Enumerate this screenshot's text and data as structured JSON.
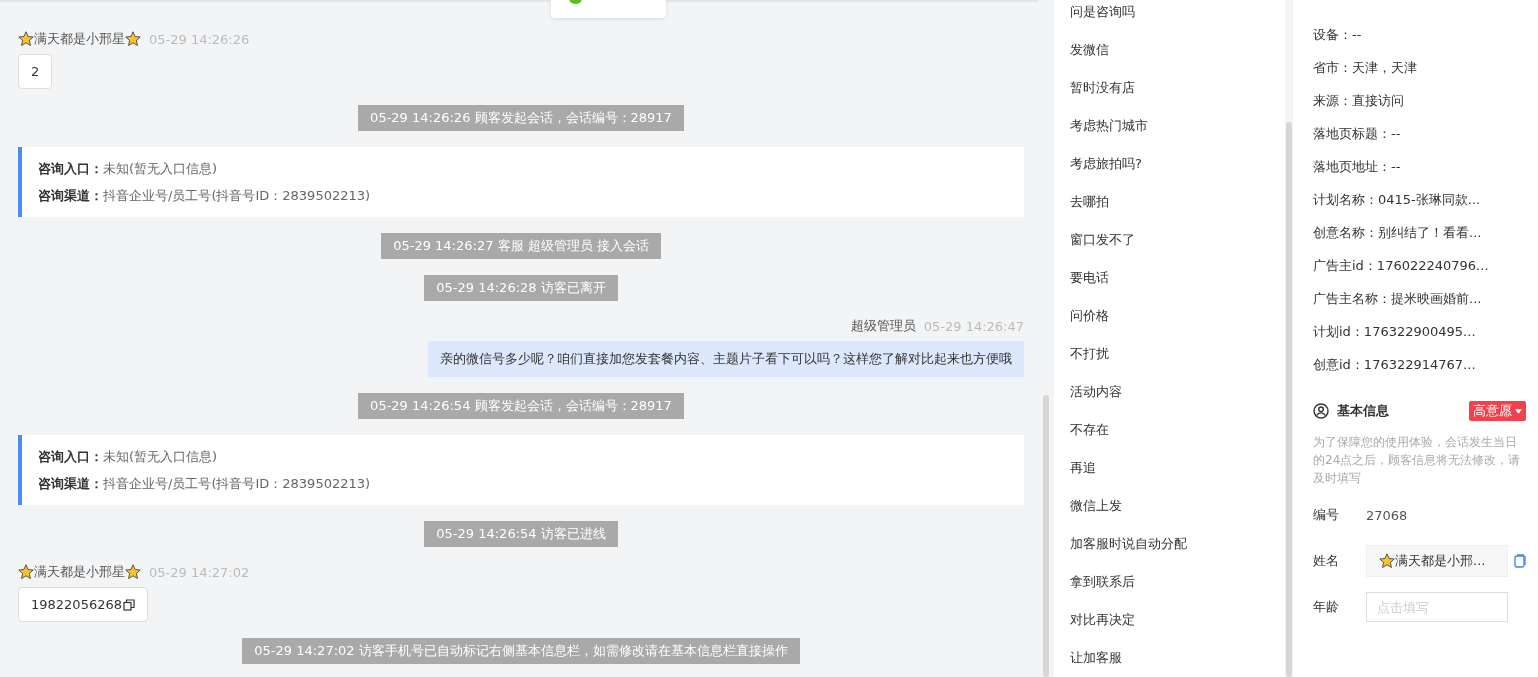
{
  "chat": [
    {
      "kind": "visitor",
      "name": "满天都是小邢星",
      "time": "05-29 14:26:26",
      "text": "2",
      "copyable": false
    },
    {
      "kind": "system",
      "text": "05-29 14:26:26 顾客发起会话，会话编号：28917"
    },
    {
      "kind": "entry",
      "rows": [
        {
          "label": "咨询入口：",
          "value": "未知(暂无入口信息)"
        },
        {
          "label": "咨询渠道：",
          "value": "抖音企业号/员工号(抖音号ID：2839502213)"
        }
      ]
    },
    {
      "kind": "system",
      "text": "05-29 14:26:27 客服 超级管理员 接入会话"
    },
    {
      "kind": "system",
      "text": "05-29 14:26:28 访客已离开"
    },
    {
      "kind": "agent",
      "name": "超级管理员",
      "time": "05-29 14:26:47",
      "text": "亲的微信号多少呢？咱们直接加您发套餐内容、主题片子看下可以吗？这样您了解对比起来也方便哦"
    },
    {
      "kind": "system",
      "text": "05-29 14:26:54 顾客发起会话，会话编号：28917"
    },
    {
      "kind": "entry",
      "rows": [
        {
          "label": "咨询入口：",
          "value": "未知(暂无入口信息)"
        },
        {
          "label": "咨询渠道：",
          "value": "抖音企业号/员工号(抖音号ID：2839502213)"
        }
      ]
    },
    {
      "kind": "system",
      "text": "05-29 14:26:54 访客已进线"
    },
    {
      "kind": "visitor",
      "name": "满天都是小邢星",
      "time": "05-29 14:27:02",
      "text": "19822056268",
      "copyable": true
    },
    {
      "kind": "system",
      "text": "05-29 14:27:02 访客手机号已自动标记右侧基本信息栏，如需修改请在基本信息栏直接操作"
    }
  ],
  "quick_replies": [
    "问是咨询吗",
    "发微信",
    "暂时没有店",
    "考虑热门城市",
    "考虑旅拍吗?",
    "去哪拍",
    "窗口发不了",
    "要电话",
    "问价格",
    "不打扰",
    "活动内容",
    "不存在",
    "再追",
    "微信上发",
    "加客服时说自动分配",
    "拿到联系后",
    "对比再决定",
    "让加客服"
  ],
  "source_info": [
    "设备：--",
    "省市：天津，天津",
    "来源：直接访问",
    "落地页标题：--",
    "落地页地址：--",
    "计划名称：0415-张琳同款...",
    "创意名称：别纠结了！看看...",
    "广告主id：176022240796...",
    "广告主名称：提米映画婚前...",
    "计划id：176322900495...",
    "创意id：176322914767..."
  ],
  "basic_info": {
    "title": "基本信息",
    "intent_tag": "高意愿",
    "notice": "为了保障您的使用体验，会话发生当日的24点之后，顾客信息将无法修改，请及时填写",
    "fields": [
      {
        "kind": "text",
        "label": "编号",
        "value": "27068"
      },
      {
        "kind": "name",
        "label": "姓名",
        "value": "满天都是小邢..."
      },
      {
        "kind": "input",
        "label": "年龄",
        "placeholder": "点击填写"
      }
    ]
  }
}
